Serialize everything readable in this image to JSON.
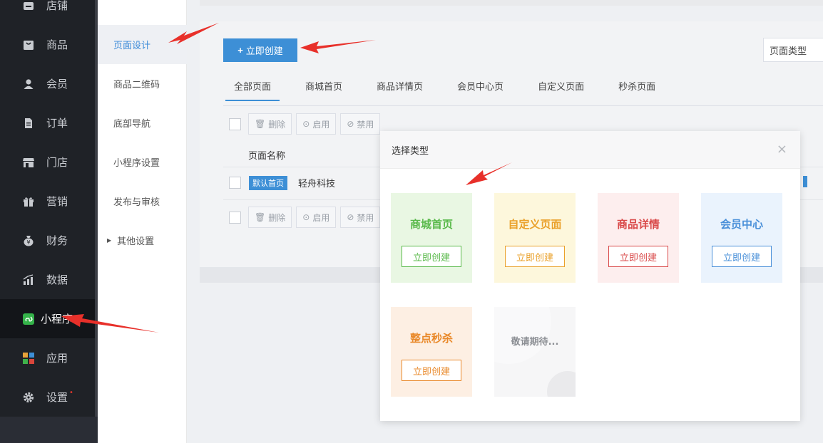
{
  "sidebar": {
    "items": [
      {
        "label": "店铺",
        "icon": "store-icon"
      },
      {
        "label": "商品",
        "icon": "product-icon"
      },
      {
        "label": "会员",
        "icon": "member-icon"
      },
      {
        "label": "订单",
        "icon": "order-icon"
      },
      {
        "label": "门店",
        "icon": "shop-icon"
      },
      {
        "label": "营销",
        "icon": "gift-icon"
      },
      {
        "label": "财务",
        "icon": "money-bag-icon"
      },
      {
        "label": "数据",
        "icon": "chart-icon"
      },
      {
        "label": "小程序",
        "icon": "miniprogram-icon",
        "active": true
      },
      {
        "label": "应用",
        "icon": "apps-icon"
      },
      {
        "label": "设置",
        "icon": "gear-icon",
        "dot": "•"
      }
    ]
  },
  "subnav": {
    "items": [
      {
        "label": "页面设计",
        "active": true
      },
      {
        "label": "商品二维码"
      },
      {
        "label": "底部导航"
      },
      {
        "label": "小程序设置"
      },
      {
        "label": "发布与审核"
      },
      {
        "label": "其他设置",
        "expandable": true
      }
    ]
  },
  "main": {
    "create_button": "立即创建",
    "page_type_select": "页面类型",
    "tabs": [
      "全部页面",
      "商城首页",
      "商品详情页",
      "会员中心页",
      "自定义页面",
      "秒杀页面"
    ],
    "toolbar": {
      "delete": "删除",
      "enable": "启用",
      "disable": "禁用"
    },
    "table_header": "页面名称",
    "row": {
      "badge": "默认首页",
      "name": "轻舟科技"
    }
  },
  "modal": {
    "title": "选择类型",
    "close": "×",
    "cards": [
      {
        "title": "商城首页",
        "button": "立即创建",
        "color": "#59b94a",
        "bg": "#e9f7e3",
        "border": "#59b94a"
      },
      {
        "title": "自定义页面",
        "button": "立即创建",
        "color": "#eaa12b",
        "bg": "#fdf7dc",
        "border": "#eaa12b"
      },
      {
        "title": "商品详情",
        "button": "立即创建",
        "color": "#d94949",
        "bg": "#fdeeee",
        "border": "#d94949"
      },
      {
        "title": "会员中心",
        "button": "立即创建",
        "color": "#4a90d9",
        "bg": "#eaf3fd",
        "border": "#4a90d9"
      },
      {
        "title": "整点秒杀",
        "button": "立即创建",
        "color": "#e9892a",
        "bg": "#fdefe3",
        "border": "#e9892a"
      }
    ],
    "coming_soon": "敬请期待..."
  },
  "colors": {
    "accent": "#3d8fd6",
    "arrow": "#e8302a"
  }
}
